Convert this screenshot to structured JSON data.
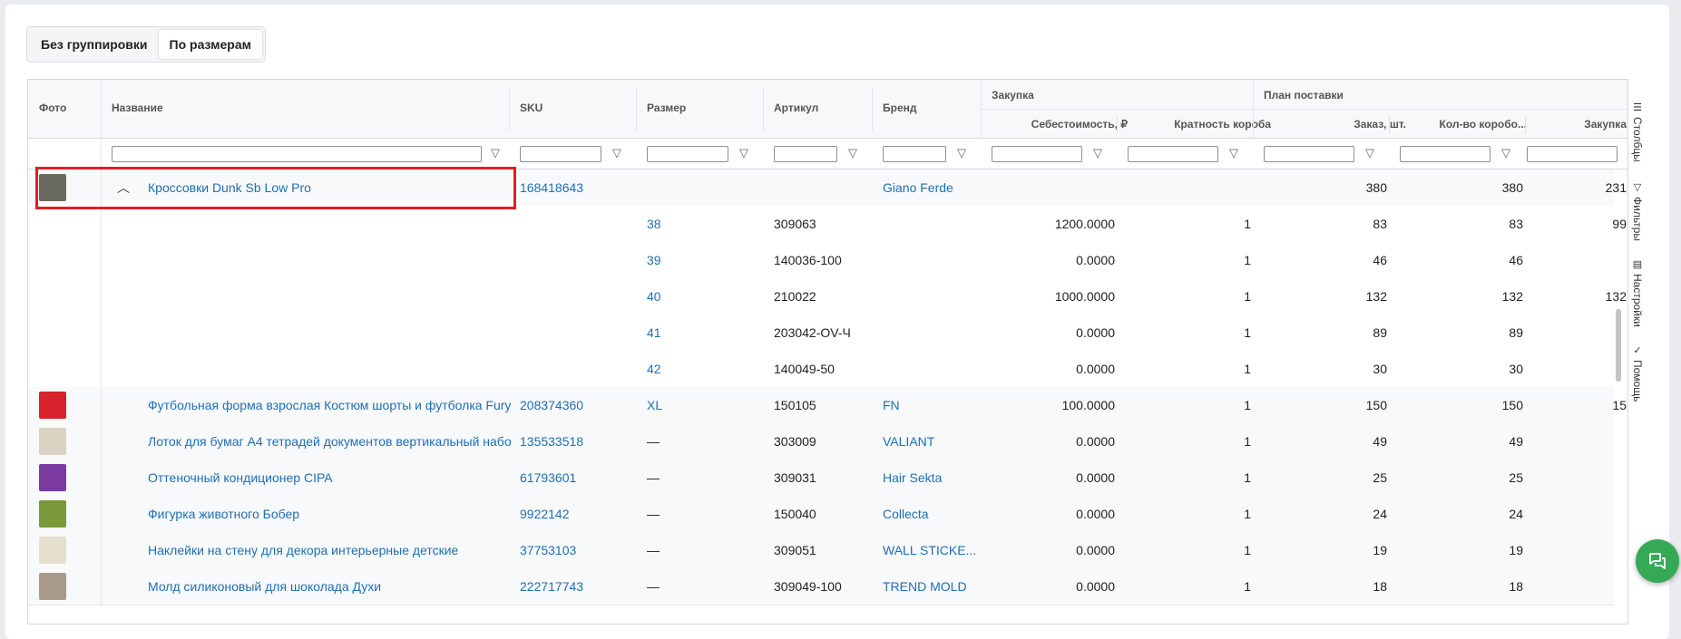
{
  "grouping": {
    "options": [
      "Без группировки",
      "По размерам"
    ],
    "active": 1
  },
  "columns": {
    "photo": "Фото",
    "name": "Название",
    "sku": "SKU",
    "size": "Размер",
    "article": "Артикул",
    "brand": "Бренд",
    "group_purchase": "Закупка",
    "cost": "Себестоимость, ₽",
    "box_multiple": "Кратность короба",
    "group_plan": "План поставки",
    "order_qty": "Заказ, шт.",
    "box_count": "Кол-во коробо...",
    "purchase_cut": "Закупка"
  },
  "rows": [
    {
      "type": "group",
      "name": "Кроссовки Dunk Sb Low Pro",
      "sku": "168418643",
      "size": "",
      "article": "",
      "brand": "Giano Ferde",
      "cost": "",
      "mult": "",
      "order": "380",
      "boxes": "380",
      "purch": "231",
      "thumb": "sneaker"
    },
    {
      "type": "child",
      "name": "",
      "sku": "",
      "size": "38",
      "article": "309063",
      "brand": "",
      "cost": "1200.0000",
      "mult": "1",
      "order": "83",
      "boxes": "83",
      "purch": "99"
    },
    {
      "type": "child",
      "name": "",
      "sku": "",
      "size": "39",
      "article": "140036-100",
      "brand": "",
      "cost": "0.0000",
      "mult": "1",
      "order": "46",
      "boxes": "46",
      "purch": ""
    },
    {
      "type": "child",
      "name": "",
      "sku": "",
      "size": "40",
      "article": "210022",
      "brand": "",
      "cost": "1000.0000",
      "mult": "1",
      "order": "132",
      "boxes": "132",
      "purch": "132"
    },
    {
      "type": "child",
      "name": "",
      "sku": "",
      "size": "41",
      "article": "203042-OV-Ч",
      "brand": "",
      "cost": "0.0000",
      "mult": "1",
      "order": "89",
      "boxes": "89",
      "purch": ""
    },
    {
      "type": "child",
      "name": "",
      "sku": "",
      "size": "42",
      "article": "140049-50",
      "brand": "",
      "cost": "0.0000",
      "mult": "1",
      "order": "30",
      "boxes": "30",
      "purch": ""
    },
    {
      "type": "item",
      "name": "Футбольная форма взрослая Костюм шорты и футболка Fury",
      "sku": "208374360",
      "size": "XL",
      "article": "150105",
      "brand": "FN",
      "cost": "100.0000",
      "mult": "1",
      "order": "150",
      "boxes": "150",
      "purch": "15",
      "thumb": "red"
    },
    {
      "type": "item",
      "name": "Лоток для бумаг А4 тетрадей документов вертикальный набо",
      "sku": "135533518",
      "size": "—",
      "article": "303009",
      "brand": "VALIANT",
      "cost": "0.0000",
      "mult": "1",
      "order": "49",
      "boxes": "49",
      "purch": "",
      "thumb": "tray"
    },
    {
      "type": "item",
      "name": "Оттеночный кондиционер CIPA",
      "sku": "61793601",
      "size": "—",
      "article": "309031",
      "brand": "Hair Sekta",
      "cost": "0.0000",
      "mult": "1",
      "order": "25",
      "boxes": "25",
      "purch": "",
      "thumb": "cipa"
    },
    {
      "type": "item",
      "name": "Фигурка животного Бобер",
      "sku": "9922142",
      "size": "—",
      "article": "150040",
      "brand": "Collecta",
      "cost": "0.0000",
      "mult": "1",
      "order": "24",
      "boxes": "24",
      "purch": "",
      "thumb": "beaver"
    },
    {
      "type": "item",
      "name": "Наклейки на стену для декора интерьерные детские",
      "sku": "37753103",
      "size": "—",
      "article": "309051",
      "brand": "WALL STICKE...",
      "cost": "0.0000",
      "mult": "1",
      "order": "19",
      "boxes": "19",
      "purch": "",
      "thumb": "sticker"
    },
    {
      "type": "item",
      "name": "Молд силиконовый для шоколада Духи",
      "sku": "222717743",
      "size": "—",
      "article": "309049-100",
      "brand": "TREND MOLD",
      "cost": "0.0000",
      "mult": "1",
      "order": "18",
      "boxes": "18",
      "purch": "",
      "thumb": "mold"
    }
  ],
  "side_tabs": [
    "Столбцы",
    "Фильтры",
    "Настройки",
    "Помощь"
  ],
  "thumb_colors": {
    "sneaker": "#6b6a5e",
    "red": "#d8232c",
    "tray": "#d9d2c2",
    "cipa": "#7b3aa0",
    "beaver": "#7a9a3a",
    "sticker": "#e4dfcf",
    "mold": "#a89a8a"
  }
}
